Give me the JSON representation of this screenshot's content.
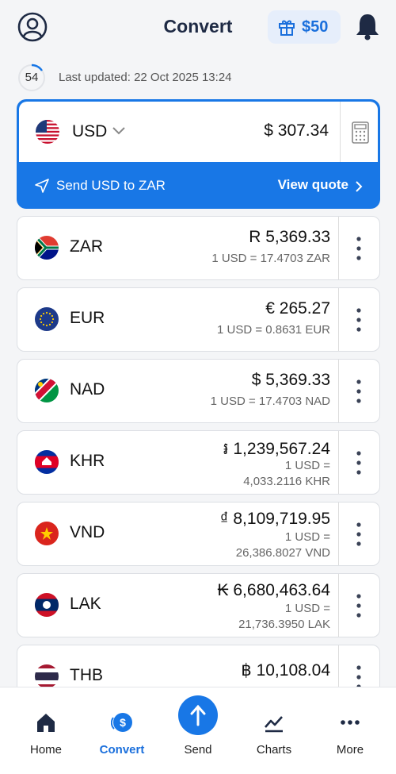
{
  "header": {
    "title": "Convert",
    "reward_amount": "$50"
  },
  "status": {
    "refresh_seconds": "54",
    "last_updated": "Last updated: 22 Oct 2025 13:24"
  },
  "base": {
    "code": "USD",
    "amount": "$ 307.34",
    "send_label": "Send USD to ZAR",
    "quote_label": "View quote"
  },
  "rows": [
    {
      "code": "ZAR",
      "amount": "R 5,369.33",
      "rate_line1": "1 USD = 17.4703 ZAR",
      "rate_line2": ""
    },
    {
      "code": "EUR",
      "amount": "€ 265.27",
      "rate_line1": "1 USD = 0.8631 EUR",
      "rate_line2": ""
    },
    {
      "code": "NAD",
      "amount": "$ 5,369.33",
      "rate_line1": "1 USD = 17.4703 NAD",
      "rate_line2": ""
    },
    {
      "code": "KHR",
      "amount": "៛ 1,239,567.24",
      "rate_line1": "1 USD =",
      "rate_line2": "4,033.2116 KHR"
    },
    {
      "code": "VND",
      "amount": "₫ 8,109,719.95",
      "rate_line1": "1 USD =",
      "rate_line2": "26,386.8027 VND"
    },
    {
      "code": "LAK",
      "amount": "₭ 6,680,463.64",
      "rate_line1": "1 USD =",
      "rate_line2": "21,736.3950 LAK"
    },
    {
      "code": "THB",
      "amount": "฿ 10,108.04",
      "rate_line1": "",
      "rate_line2": ""
    }
  ],
  "nav": {
    "home": "Home",
    "convert": "Convert",
    "send": "Send",
    "charts": "Charts",
    "more": "More"
  },
  "colors": {
    "accent": "#1877e6",
    "title": "#1e2a44"
  },
  "icons": [
    "user-icon",
    "gift-icon",
    "bell-icon",
    "chevron-down-icon",
    "calculator-icon",
    "paper-plane-icon",
    "chevron-right-icon",
    "kebab-menu-icon",
    "home-icon",
    "convert-icon",
    "arrow-up-icon",
    "chart-icon",
    "more-icon"
  ]
}
